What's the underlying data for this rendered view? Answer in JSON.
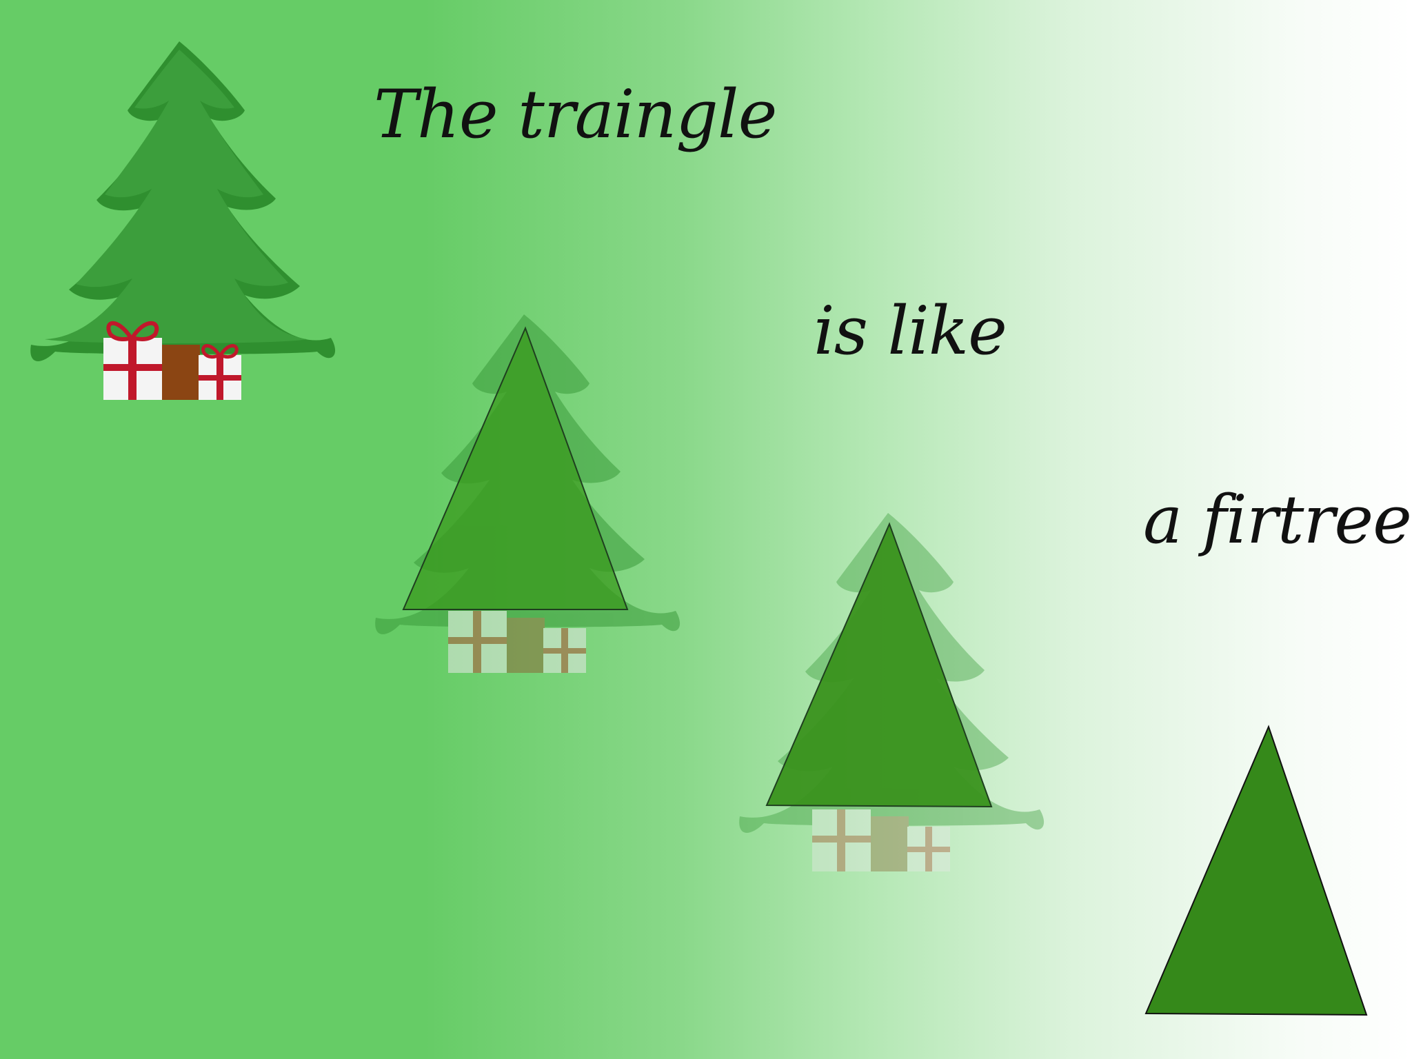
{
  "captions": {
    "line1": "The traingle",
    "line2": "is like",
    "line3": "a firtree"
  },
  "icons": [
    "fir-tree-with-gifts-icon",
    "fir-tree-with-triangle-overlay-icon",
    "triangle-icon"
  ],
  "colors": {
    "background_left": "#66cc66",
    "background_right": "#ffffff",
    "tree_green": "#2f8f2f",
    "tree_light": "#3fa43f",
    "triangle_green": "#35891a",
    "gift_ribbon": "#c0182b",
    "text": "#111111"
  }
}
